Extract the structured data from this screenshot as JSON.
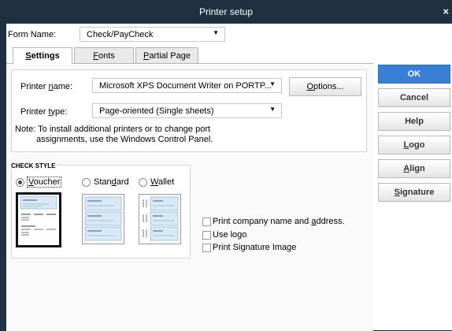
{
  "window": {
    "title": "Printer setup",
    "close_label": "×"
  },
  "form_name": {
    "label": "Form Name:",
    "value": "Check/PayCheck"
  },
  "tabs": [
    {
      "label": "Settings",
      "underline": "S",
      "rest": "ettings",
      "active": true
    },
    {
      "label": "Fonts",
      "underline": "F",
      "rest": "onts",
      "active": false
    },
    {
      "label": "Partial Page",
      "underline": "P",
      "rest": "artial Page",
      "active": false
    }
  ],
  "printer": {
    "name_label_pre": "Printer ",
    "name_label_u": "n",
    "name_label_post": "ame:",
    "name_value": "Microsoft XPS Document Writer on PORTP...",
    "type_label_pre": "Printer ",
    "type_label_u": "t",
    "type_label_post": "ype:",
    "type_value": "Page-oriented (Single sheets)",
    "options_pre": "",
    "options_u": "O",
    "options_post": "ptions...",
    "note_line1": "Note: To install additional printers or to change port",
    "note_line2": "assignments, use the Windows Control Panel."
  },
  "check_style": {
    "heading": "CHECK STYLE",
    "options": [
      {
        "pre": "",
        "u": "V",
        "post": "oucher",
        "selected": true
      },
      {
        "pre": "Stan",
        "u": "d",
        "post": "ard",
        "selected": false
      },
      {
        "pre": "",
        "u": "W",
        "post": "allet",
        "selected": false
      }
    ]
  },
  "print_options": [
    {
      "pre": "Print company name and ",
      "u": "a",
      "post": "ddress.",
      "checked": false
    },
    {
      "pre": "Use logo",
      "u": "",
      "post": "",
      "checked": false
    },
    {
      "pre": "Print Signature Image",
      "u": "",
      "post": "",
      "checked": false
    }
  ],
  "buttons": {
    "ok": "OK",
    "cancel": "Cancel",
    "help": "Help",
    "logo_u": "L",
    "logo_post": "ogo",
    "align_u": "A",
    "align_post": "lign",
    "signature_u": "S",
    "signature_post": "ignature"
  }
}
